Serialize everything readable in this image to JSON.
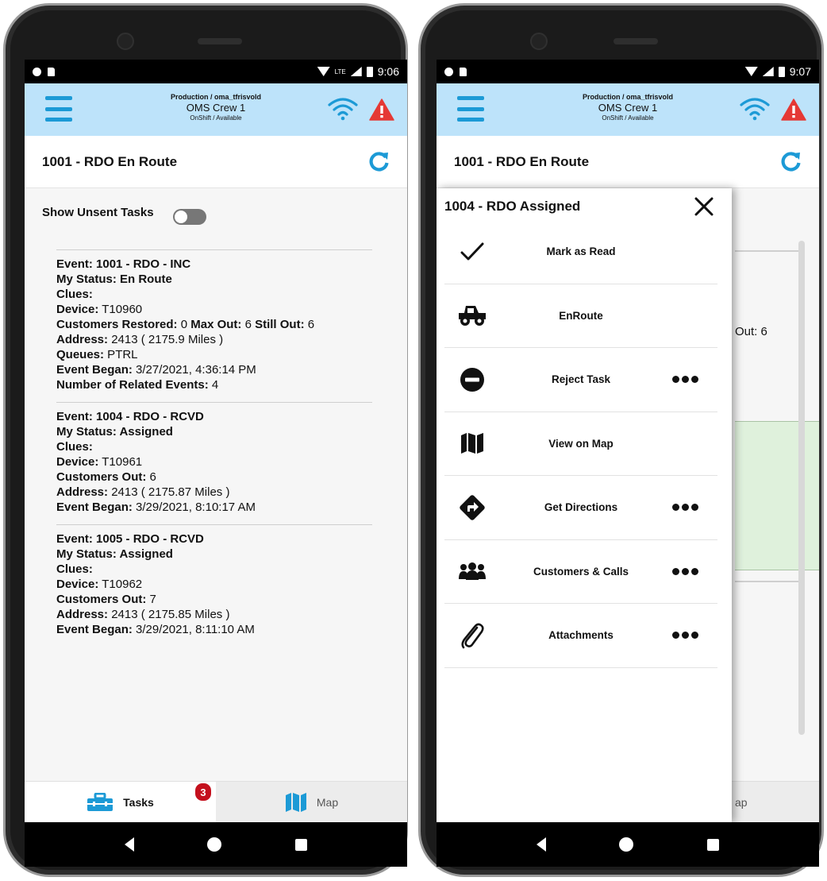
{
  "status_bar": {
    "left_time": "9:06",
    "right_time": "9:07",
    "network": "LTE"
  },
  "app_bar": {
    "environment": "Production / oma_tfrisvold",
    "crew": "OMS Crew 1",
    "shift_status": "OnShift / Available",
    "wifi_color": "#1c9ad6",
    "alert_color": "#e53935"
  },
  "title_bar": {
    "title": "1001 - RDO En Route"
  },
  "toggle": {
    "label": "Show Unsent Tasks",
    "enabled": false
  },
  "events": [
    {
      "lines": [
        {
          "label": "Event: 1001 - RDO - INC",
          "value": ""
        },
        {
          "label": "My Status: En Route",
          "value": ""
        },
        {
          "label": "Clues:",
          "value": ""
        },
        {
          "label": "Device:",
          "value": " T10960"
        },
        {
          "label": "Customers Restored:",
          "value": " 0 ",
          "label2": "Max Out:",
          "value2": " 6 ",
          "label3": "Still Out:",
          "value3": " 6"
        },
        {
          "label": "Address:",
          "value": " 2413 ( 2175.9 Miles )"
        },
        {
          "label": "Queues:",
          "value": " PTRL"
        },
        {
          "label": "Event Began:",
          "value": " 3/27/2021, 4:36:14 PM"
        },
        {
          "label": "Number of Related Events:",
          "value": " 4"
        }
      ]
    },
    {
      "lines": [
        {
          "label": "Event: 1004 - RDO - RCVD",
          "value": ""
        },
        {
          "label": "My Status: Assigned",
          "value": ""
        },
        {
          "label": "Clues:",
          "value": ""
        },
        {
          "label": "Device:",
          "value": " T10961"
        },
        {
          "label": "Customers Out:",
          "value": " 6"
        },
        {
          "label": "Address:",
          "value": " 2413 ( 2175.87 Miles )"
        },
        {
          "label": "Event Began:",
          "value": " 3/29/2021, 8:10:17 AM"
        }
      ]
    },
    {
      "lines": [
        {
          "label": "Event: 1005 - RDO - RCVD",
          "value": ""
        },
        {
          "label": "My Status: Assigned",
          "value": ""
        },
        {
          "label": "Clues:",
          "value": ""
        },
        {
          "label": "Device:",
          "value": " T10962"
        },
        {
          "label": "Customers Out:",
          "value": " 7"
        },
        {
          "label": "Address:",
          "value": " 2413 ( 2175.85 Miles )"
        },
        {
          "label": "Event Began:",
          "value": " 3/29/2021, 8:11:10 AM"
        }
      ]
    }
  ],
  "bottom_tabs": {
    "tasks_label": "Tasks",
    "tasks_badge": "3",
    "map_label": "Map",
    "map_peek": "ap",
    "accent": "#1c9ad6"
  },
  "peek": {
    "still_out": "Out: 6"
  },
  "drawer": {
    "title": "1004 - RDO Assigned",
    "items": [
      {
        "label": "Mark as Read",
        "icon": "check-icon",
        "more": false
      },
      {
        "label": "EnRoute",
        "icon": "truck-icon",
        "more": false
      },
      {
        "label": "Reject Task",
        "icon": "minus-circle-icon",
        "more": true
      },
      {
        "label": "View on Map",
        "icon": "map-icon",
        "more": false
      },
      {
        "label": "Get Directions",
        "icon": "directions-icon",
        "more": true
      },
      {
        "label": "Customers & Calls",
        "icon": "users-icon",
        "more": true
      },
      {
        "label": "Attachments",
        "icon": "paperclip-icon",
        "more": true
      }
    ]
  }
}
